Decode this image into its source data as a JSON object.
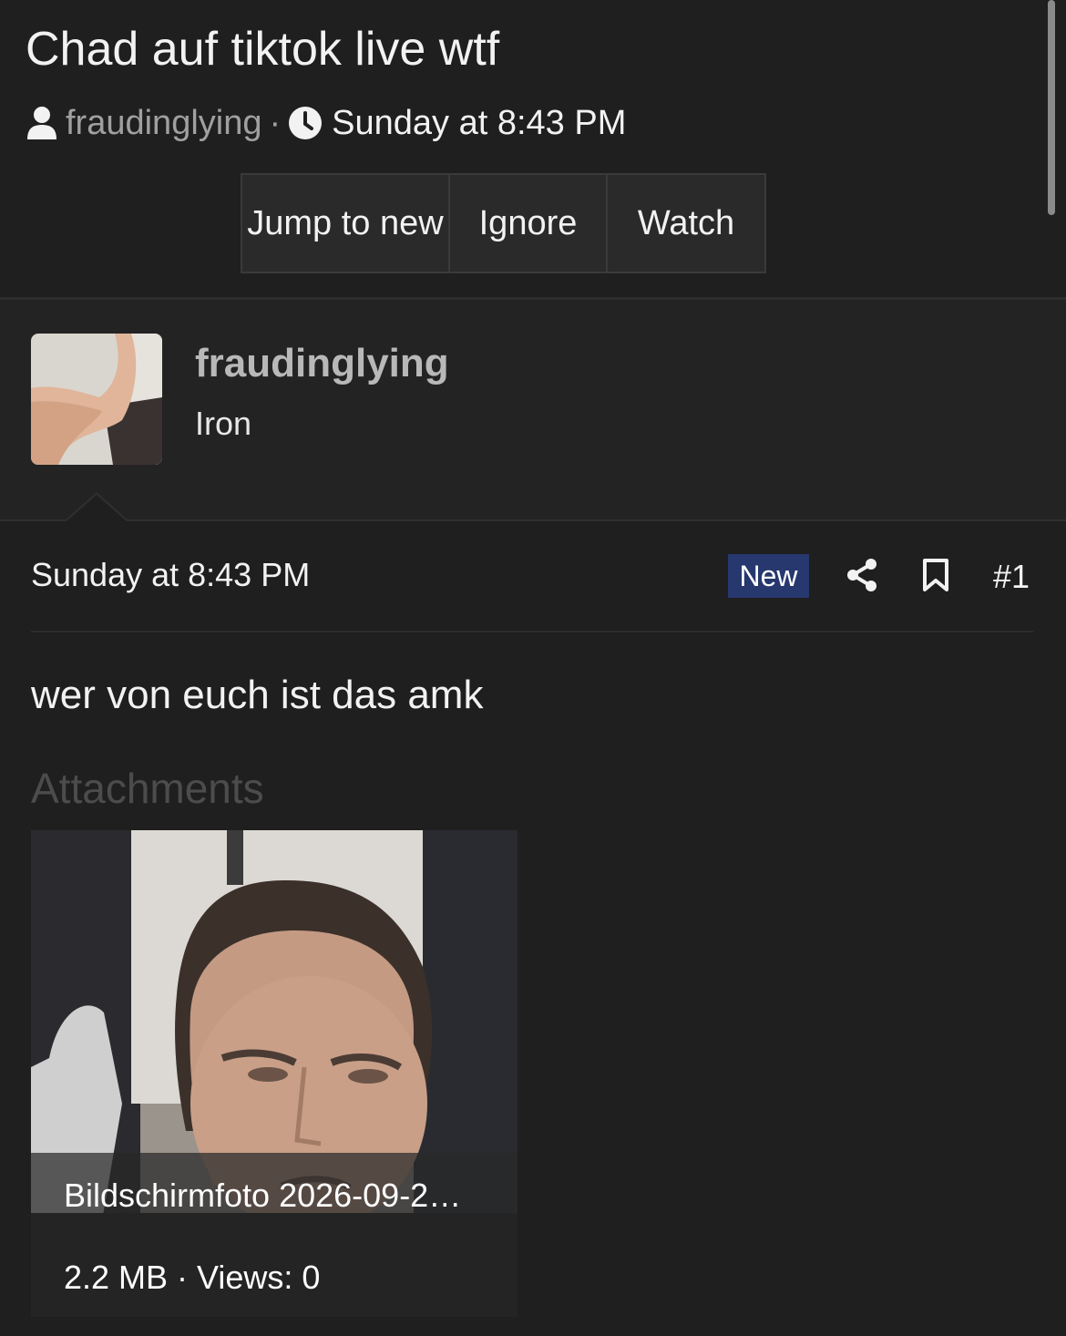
{
  "thread": {
    "title": "Chad auf tiktok live wtf",
    "starter": "fraudinglying",
    "separator": "·",
    "date": "Sunday at 8:43 PM"
  },
  "actions": {
    "jump_to_new": "Jump to new",
    "ignore": "Ignore",
    "watch": "Watch"
  },
  "post": {
    "author": "fraudinglying",
    "author_title": "Iron",
    "date": "Sunday at 8:43 PM",
    "badge": "New",
    "number": "#1",
    "body": "wer von euch ist das amk",
    "attachments_heading": "Attachments",
    "attachment": {
      "filename": "Bildschirmfoto 2026-09-2…",
      "meta": "2.2 MB · Views: 0"
    }
  },
  "icons": {
    "user": "user-icon",
    "clock": "clock-icon",
    "share": "share-icon",
    "bookmark": "bookmark-icon"
  },
  "colors": {
    "background": "#1f1f20",
    "badge_bg": "#26386e",
    "muted_text": "#a0a0a0"
  }
}
